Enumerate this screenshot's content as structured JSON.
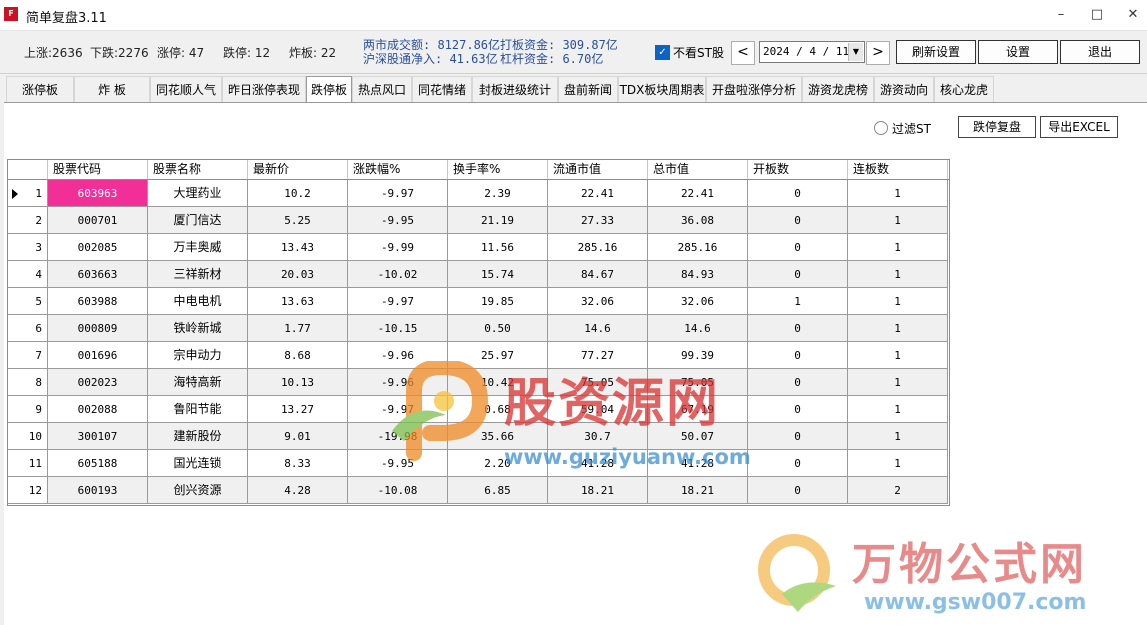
{
  "window": {
    "title": "简单复盘3.11",
    "minimize": "–",
    "maximize": "□",
    "close": "✕"
  },
  "stats": {
    "up": "上涨:2636",
    "down": "下跌:2276",
    "limit_up": "涨停: 47",
    "limit_down": "跌停: 12",
    "broken": "炸板: 22",
    "turnover": "两市成交额: 8127.86亿",
    "northbound": "沪深股通净入: 41.63亿",
    "board_funds": "打板资金: 309.87亿",
    "leverage_funds": "杠杆资金: 6.70亿"
  },
  "controls": {
    "hide_st_label": "不看ST股",
    "hide_st_checked": true,
    "prev": "<",
    "next": ">",
    "date": "2024 / 4 / 11",
    "dropdown": "▼",
    "refresh_settings": "刷新设置",
    "settings": "设置",
    "exit": "退出"
  },
  "tabs": [
    {
      "label": "涨停板",
      "active": false
    },
    {
      "label": "炸  板",
      "active": false
    },
    {
      "label": "同花顺人气",
      "active": false
    },
    {
      "label": "昨日涨停表现",
      "active": false
    },
    {
      "label": "跌停板",
      "active": true
    },
    {
      "label": "热点风口",
      "active": false
    },
    {
      "label": "同花情绪",
      "active": false
    },
    {
      "label": "封板进级统计",
      "active": false
    },
    {
      "label": "盘前新闻",
      "active": false
    },
    {
      "label": "TDX板块周期表",
      "active": false
    },
    {
      "label": "开盘啦涨停分析",
      "active": false
    },
    {
      "label": "游资龙虎榜",
      "active": false
    },
    {
      "label": "游资动向",
      "active": false
    },
    {
      "label": "核心龙虎",
      "active": false
    }
  ],
  "filter": {
    "filter_st": "过滤ST",
    "review_button": "跌停复盘",
    "export_button": "导出EXCEL"
  },
  "table": {
    "columns": [
      "股票代码",
      "股票名称",
      "最新价",
      "涨跌幅%",
      "换手率%",
      "流通市值",
      "总市值",
      "开板数",
      "连板数"
    ],
    "rows": [
      {
        "no": "1",
        "code": "603963",
        "name": "大理药业",
        "price": "10.2",
        "change": "-9.97",
        "turnover": "2.39",
        "float_cap": "22.41",
        "total_cap": "22.41",
        "opens": "0",
        "boards": "1"
      },
      {
        "no": "2",
        "code": "000701",
        "name": "厦门信达",
        "price": "5.25",
        "change": "-9.95",
        "turnover": "21.19",
        "float_cap": "27.33",
        "total_cap": "36.08",
        "opens": "0",
        "boards": "1"
      },
      {
        "no": "3",
        "code": "002085",
        "name": "万丰奥威",
        "price": "13.43",
        "change": "-9.99",
        "turnover": "11.56",
        "float_cap": "285.16",
        "total_cap": "285.16",
        "opens": "0",
        "boards": "1"
      },
      {
        "no": "4",
        "code": "603663",
        "name": "三祥新材",
        "price": "20.03",
        "change": "-10.02",
        "turnover": "15.74",
        "float_cap": "84.67",
        "total_cap": "84.93",
        "opens": "0",
        "boards": "1"
      },
      {
        "no": "5",
        "code": "603988",
        "name": "中电电机",
        "price": "13.63",
        "change": "-9.97",
        "turnover": "19.85",
        "float_cap": "32.06",
        "total_cap": "32.06",
        "opens": "1",
        "boards": "1"
      },
      {
        "no": "6",
        "code": "000809",
        "name": "铁岭新城",
        "price": "1.77",
        "change": "-10.15",
        "turnover": "0.50",
        "float_cap": "14.6",
        "total_cap": "14.6",
        "opens": "0",
        "boards": "1"
      },
      {
        "no": "7",
        "code": "001696",
        "name": "宗申动力",
        "price": "8.68",
        "change": "-9.96",
        "turnover": "25.97",
        "float_cap": "77.27",
        "total_cap": "99.39",
        "opens": "0",
        "boards": "1"
      },
      {
        "no": "8",
        "code": "002023",
        "name": "海特高新",
        "price": "10.13",
        "change": "-9.96",
        "turnover": "10.42",
        "float_cap": "75.05",
        "total_cap": "75.05",
        "opens": "0",
        "boards": "1"
      },
      {
        "no": "9",
        "code": "002088",
        "name": "鲁阳节能",
        "price": "13.27",
        "change": "-9.97",
        "turnover": "0.68",
        "float_cap": "59.04",
        "total_cap": "67.19",
        "opens": "0",
        "boards": "1"
      },
      {
        "no": "10",
        "code": "300107",
        "name": "建新股份",
        "price": "9.01",
        "change": "-19.98",
        "turnover": "35.66",
        "float_cap": "30.7",
        "total_cap": "50.07",
        "opens": "0",
        "boards": "1"
      },
      {
        "no": "11",
        "code": "605188",
        "name": "国光连锁",
        "price": "8.33",
        "change": "-9.95",
        "turnover": "2.20",
        "float_cap": "41.28",
        "total_cap": "41.28",
        "opens": "0",
        "boards": "1"
      },
      {
        "no": "12",
        "code": "600193",
        "name": "创兴资源",
        "price": "4.28",
        "change": "-10.08",
        "turnover": "6.85",
        "float_cap": "18.21",
        "total_cap": "18.21",
        "opens": "0",
        "boards": "2"
      }
    ]
  },
  "watermarks": {
    "site1_name": "股资源网",
    "site1_url": "www.guziyuanw.com",
    "site2_name": "万物公式网",
    "site2_url": "www.gsw007.com"
  },
  "colors": {
    "selected_cell": "#f22f96",
    "alt_row": "#f0f0f0",
    "stats_blue": "#2a4f9e",
    "checkbox": "#0b63c4"
  }
}
